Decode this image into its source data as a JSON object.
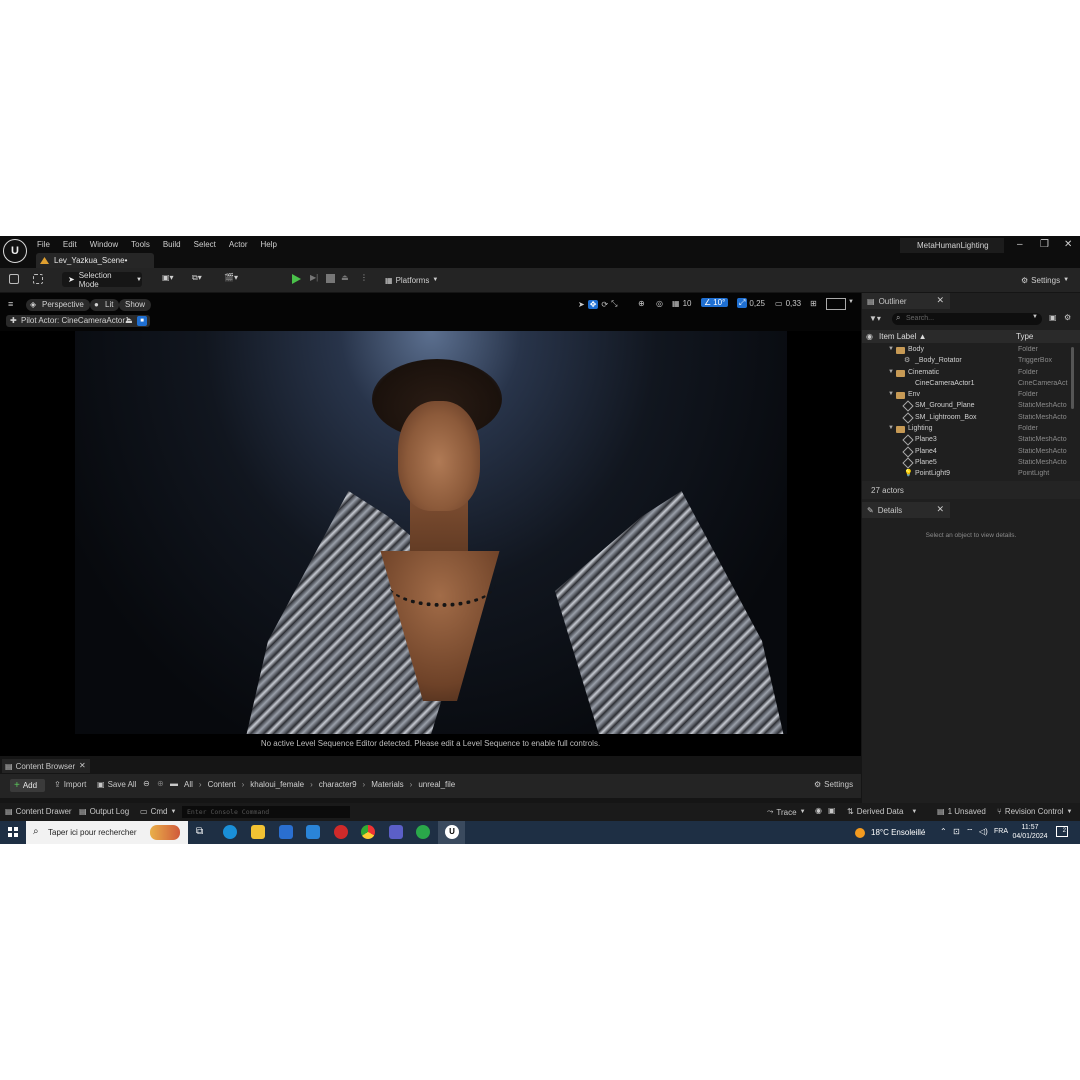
{
  "titlebar": {
    "menus": [
      "File",
      "Edit",
      "Window",
      "Tools",
      "Build",
      "Select",
      "Actor",
      "Help"
    ],
    "level_tab": "Lev_Yazkua_Scene•",
    "project": "MetaHumanLighting"
  },
  "toolbar": {
    "selection_mode": "Selection Mode",
    "platforms": "Platforms",
    "settings": "Settings"
  },
  "viewport": {
    "perspective": "Perspective",
    "lit": "Lit",
    "show": "Show",
    "pilot": "Pilot Actor: CineCameraActor1",
    "grid_snap": "10",
    "rot_snap": "10°",
    "scale_snap": "0,25",
    "cam_speed": "0,33",
    "message": "No active Level Sequence Editor detected. Please edit a Level Sequence to enable full controls."
  },
  "outliner": {
    "tab": "Outliner",
    "search_placeholder": "Search...",
    "col_label": "Item Label ▲",
    "col_type": "Type",
    "rows": [
      {
        "label": "Body",
        "type": "Folder"
      },
      {
        "label": "_Body_Rotator",
        "type": "TriggerBox"
      },
      {
        "label": "Cinematic",
        "type": "Folder"
      },
      {
        "label": "CineCameraActor1",
        "type": "CineCameraAct"
      },
      {
        "label": "Env",
        "type": "Folder"
      },
      {
        "label": "SM_Ground_Plane",
        "type": "StaticMeshActo"
      },
      {
        "label": "SM_Lightroom_Box",
        "type": "StaticMeshActo"
      },
      {
        "label": "Lighting",
        "type": "Folder"
      },
      {
        "label": "Plane3",
        "type": "StaticMeshActo"
      },
      {
        "label": "Plane4",
        "type": "StaticMeshActo"
      },
      {
        "label": "Plane5",
        "type": "StaticMeshActo"
      },
      {
        "label": "PointLight9",
        "type": "PointLight"
      }
    ],
    "actors": "27 actors"
  },
  "details": {
    "tab": "Details",
    "empty": "Select an object to view details."
  },
  "content_browser": {
    "tab": "Content Browser",
    "add": "Add",
    "import": "Import",
    "save_all": "Save All",
    "path": [
      "All",
      "Content",
      "khaloui_female",
      "character9",
      "Materials",
      "unreal_file"
    ],
    "settings": "Settings"
  },
  "status": {
    "content_drawer": "Content Drawer",
    "output_log": "Output Log",
    "cmd": "Cmd",
    "console_placeholder": "Enter Console Command",
    "trace": "Trace",
    "derived_data": "Derived Data",
    "unsaved": "1 Unsaved",
    "revision": "Revision Control"
  },
  "taskbar": {
    "search": "Taper ici pour rechercher",
    "weather": "18°C  Ensoleillé",
    "lang": "FRA",
    "time": "11:57",
    "date": "04/01/2024",
    "notif_count": "2"
  },
  "colors": {
    "accent_blue": "#1f6fd1",
    "play_green": "#4ac14a",
    "folder": "#c79a55"
  }
}
